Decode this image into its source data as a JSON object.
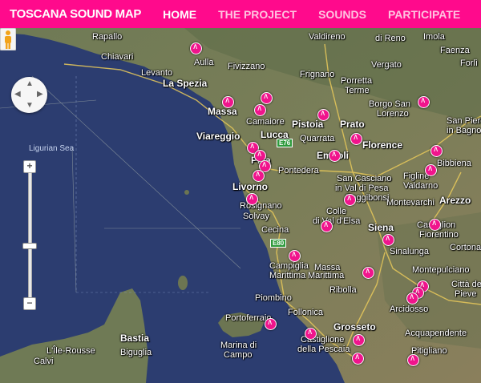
{
  "header": {
    "brand": "TOSCANA SOUND MAP",
    "nav": [
      {
        "label": "HOME",
        "active": true
      },
      {
        "label": "THE PROJECT",
        "active": false
      },
      {
        "label": "SOUNDS",
        "active": false
      },
      {
        "label": "PARTICIPATE",
        "active": false
      }
    ],
    "colors": {
      "bar": "#ff0a8c",
      "active": "#ffffff",
      "inactive": "#ffc3e0"
    }
  },
  "map": {
    "controls": {
      "pan": "pan-control",
      "street_view": "pegman-icon",
      "zoom_in": "+",
      "zoom_out": "−"
    },
    "places": {
      "rapallo": "Rapallo",
      "chiavari": "Chiavari",
      "levanto": "Levanto",
      "la_spezia": "La Spezia",
      "aulla": "Aulla",
      "fivizzano": "Fivizzano",
      "massa": "Massa",
      "camaiore": "Camaiore",
      "viareggio": "Viareggio",
      "lucca": "Lucca",
      "pistoia": "Pistoia",
      "prato": "Prato",
      "quarrata": "Quarrata",
      "empoli": "Empoli",
      "florence": "Florence",
      "pisa": "Pisa",
      "pontedera": "Pontedera",
      "livorno": "Livorno",
      "rosignano": "Rosignano",
      "solvay": "Solvay",
      "cecina": "Cecina",
      "campiglia": "Campiglia",
      "marittima": "Marittima",
      "massa_marittima": "Massa",
      "marittima2": "Marittima",
      "piombino": "Piombino",
      "follonica": "Follonica",
      "portoferraio": "Portoferraio",
      "marina_di_campo": "Marina di",
      "campo": "Campo",
      "bastia": "Bastia",
      "biguglia": "Biguglia",
      "lile_rousse": "L'Île-Rousse",
      "calvi": "Calvi",
      "grosseto": "Grosseto",
      "castiglione": "Castiglione",
      "della_pescaia": "della Pescaia",
      "ribolla": "Ribolla",
      "siena": "Siena",
      "poggibonsi": "Poggibonsi",
      "colle": "Colle",
      "di_val_d_elsa": "di Val d'Elsa",
      "san_casciano": "San Casciano",
      "in_val_di_pesa": "in Val di Pesa",
      "montevarchi": "Montevarchi",
      "figline": "Figline",
      "valdarno": "Valdarno",
      "arezzo": "Arezzo",
      "castiglion": "Castiglion",
      "fiorentino": "Fiorentino",
      "sinalunga": "Sinalunga",
      "montepulciano": "Montepulciano",
      "cortona": "Cortona",
      "citta_della": "Città della",
      "pieve": "Pieve",
      "arcidosso": "Arcidosso",
      "acquapendente": "Acquapendente",
      "pitigliano": "Pitigliano",
      "bibbiena": "Bibbiena",
      "san_piero": "San Piero",
      "in_bagno": "in Bagno",
      "borgo_san": "Borgo San",
      "lorenzo": "Lorenzo",
      "imola": "Imola",
      "faenza": "Faenza",
      "forli": "Forlì",
      "frignano": "Frignano",
      "porretta": "Porretta",
      "terme": "Terme",
      "di_reno": "di Reno",
      "vergato": "Vergato",
      "val_d_reno": "Valdireno",
      "ligurian_sea": "Ligurian Sea",
      "e76": "E76",
      "e80": "E80"
    }
  }
}
